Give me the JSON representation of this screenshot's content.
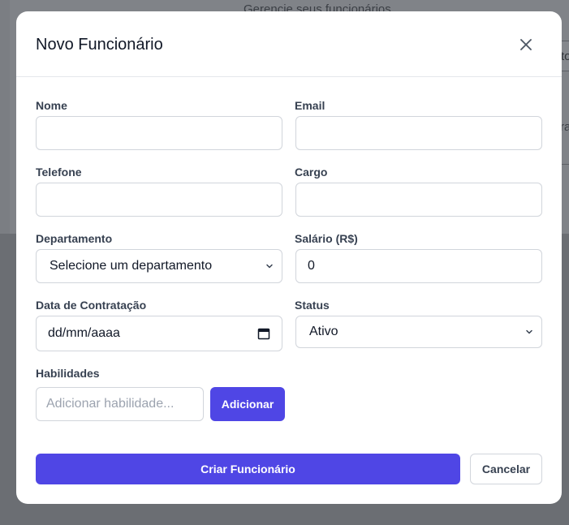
{
  "background": {
    "subtitle": "Gerencie seus funcionários",
    "field_fragment": "to",
    "text_fragment": "ra"
  },
  "modal": {
    "title": "Novo Funcionário",
    "close_icon": "close-icon"
  },
  "form": {
    "nome": {
      "label": "Nome",
      "value": ""
    },
    "email": {
      "label": "Email",
      "value": ""
    },
    "telefone": {
      "label": "Telefone",
      "value": ""
    },
    "cargo": {
      "label": "Cargo",
      "value": ""
    },
    "departamento": {
      "label": "Departamento",
      "selected": "Selecione um departamento"
    },
    "salario": {
      "label": "Salário (R$)",
      "value": "0"
    },
    "data_contratacao": {
      "label": "Data de Contratação",
      "value": "dd/mm/aaaa",
      "icon": "calendar-icon"
    },
    "status": {
      "label": "Status",
      "selected": "Ativo"
    },
    "habilidades": {
      "label": "Habilidades",
      "placeholder": "Adicionar habilidade...",
      "add_label": "Adicionar"
    }
  },
  "actions": {
    "create_label": "Criar Funcionário",
    "cancel_label": "Cancelar"
  },
  "colors": {
    "primary": "#4f46e5",
    "border": "#d1d5db",
    "overlay": "#6b6e73"
  }
}
